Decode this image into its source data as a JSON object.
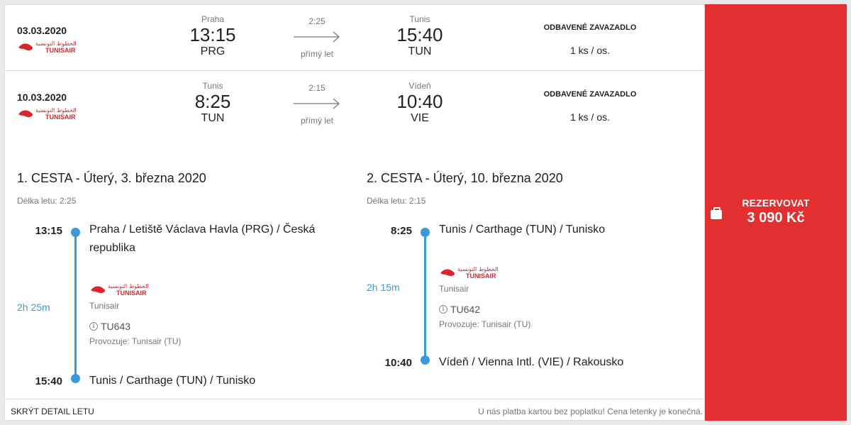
{
  "legs": [
    {
      "date": "03.03.2020",
      "airline_logo": "tunisair-logo",
      "dep_city": "Praha",
      "dep_time": "13:15",
      "dep_code": "PRG",
      "duration": "2:25",
      "type": "přímý let",
      "arr_city": "Tunis",
      "arr_time": "15:40",
      "arr_code": "TUN",
      "bag_title": "ODBAVENÉ ZAVAZADLO",
      "bag_value": "1 ks / os."
    },
    {
      "date": "10.03.2020",
      "airline_logo": "tunisair-logo",
      "dep_city": "Tunis",
      "dep_time": "8:25",
      "dep_code": "TUN",
      "duration": "2:15",
      "type": "přímý let",
      "arr_city": "Vídeň",
      "arr_time": "10:40",
      "arr_code": "VIE",
      "bag_title": "ODBAVENÉ ZAVAZADLO",
      "bag_value": "1 ks / os."
    }
  ],
  "details": [
    {
      "title": "1. CESTA - Úterý, 3. března 2020",
      "length": "Délka letu: 2:25",
      "dep_time": "13:15",
      "dep_place": "Praha / Letiště Václava Havla (PRG) / Česká republika",
      "duration": "2h 25m",
      "airline": "Tunisair",
      "flight_no": "TU643",
      "operated": "Provozuje: Tunisair (TU)",
      "arr_time": "15:40",
      "arr_place": "Tunis / Carthage (TUN) / Tunisko"
    },
    {
      "title": "2. CESTA - Úterý, 10. března 2020",
      "length": "Délka letu: 2:15",
      "dep_time": "8:25",
      "dep_place": "Tunis / Carthage (TUN) / Tunisko",
      "duration": "2h 15m",
      "airline": "Tunisair",
      "flight_no": "TU642",
      "operated": "Provozuje: Tunisair (TU)",
      "arr_time": "10:40",
      "arr_place": "Vídeň / Vienna Intl. (VIE) / Rakousko"
    }
  ],
  "logo_text": {
    "arabic": "الخطوط التونسية",
    "latin": "TUNISAIR"
  },
  "footer": {
    "hide_label": "SKRÝT DETAIL LETU",
    "note": "U nás platba kartou bez poplatku! Cena letenky je konečná."
  },
  "cta": {
    "label": "REZERVOVAT",
    "price": "3 090 Kč",
    "icon": "briefcase-icon"
  },
  "colors": {
    "accent": "#e32f2f",
    "timeline": "#3a9ad9"
  }
}
